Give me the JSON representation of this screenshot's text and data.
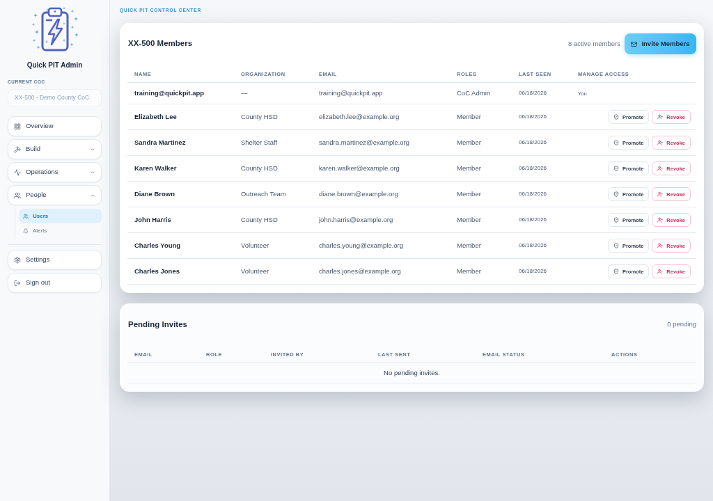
{
  "sidebar": {
    "app_title": "Quick PIT Admin",
    "coc_label": "CURRENT COC",
    "coc_field": {
      "value": "XX-500 - Demo County CoC",
      "disabled": true
    },
    "nav": [
      {
        "kind": "link",
        "label": "Overview"
      },
      {
        "kind": "group",
        "label": "Build",
        "expanded": false
      },
      {
        "kind": "group",
        "label": "Operations",
        "expanded": false
      },
      {
        "kind": "group",
        "label": "People",
        "expanded": true,
        "children": [
          {
            "label": "Users",
            "selected": true
          },
          {
            "label": "Alerts",
            "selected": false
          }
        ]
      }
    ],
    "footer_nav": [
      {
        "label": "Settings"
      },
      {
        "label": "Sign out"
      }
    ]
  },
  "header": {
    "eyebrow": "QUICK PIT CONTROL CENTER"
  },
  "members_card": {
    "title": "XX-500 Members",
    "count": "8 active members",
    "invite_button": "Invite Members",
    "table": {
      "columns": [
        "NAME",
        "ORGANIZATION",
        "EMAIL",
        "ROLES",
        "LAST SEEN",
        "MANAGE ACCESS"
      ],
      "rows": [
        {
          "name": "training@quickpit.app",
          "organization": "—",
          "email": "training@quickpit.app",
          "roles": "CoC Admin",
          "last_seen": "06/18/2026",
          "manage_access": [
            {
              "kind": "note",
              "label": "You"
            }
          ]
        },
        {
          "name": "Elizabeth Lee",
          "organization": "County HSD",
          "email": "elizabeth.lee@example.org",
          "roles": "Member",
          "last_seen": "06/18/2026",
          "manage_access": [
            {
              "kind": "promote",
              "label": "Promote"
            },
            {
              "kind": "revoke",
              "label": "Revoke"
            }
          ]
        },
        {
          "name": "Sandra Martinez",
          "organization": "Shelter Staff",
          "email": "sandra.martinez@example.org",
          "roles": "Member",
          "last_seen": "06/18/2026",
          "manage_access": [
            {
              "kind": "promote",
              "label": "Promote"
            },
            {
              "kind": "revoke",
              "label": "Revoke"
            }
          ]
        },
        {
          "name": "Karen Walker",
          "organization": "County HSD",
          "email": "karen.walker@example.org",
          "roles": "Member",
          "last_seen": "06/18/2026",
          "manage_access": [
            {
              "kind": "promote",
              "label": "Promote"
            },
            {
              "kind": "revoke",
              "label": "Revoke"
            }
          ]
        },
        {
          "name": "Diane Brown",
          "organization": "Outreach Team",
          "email": "diane.brown@example.org",
          "roles": "Member",
          "last_seen": "06/18/2026",
          "manage_access": [
            {
              "kind": "promote",
              "label": "Promote"
            },
            {
              "kind": "revoke",
              "label": "Revoke"
            }
          ]
        },
        {
          "name": "John Harris",
          "organization": "County HSD",
          "email": "john.harris@example.org",
          "roles": "Member",
          "last_seen": "06/18/2026",
          "manage_access": [
            {
              "kind": "promote",
              "label": "Promote"
            },
            {
              "kind": "revoke",
              "label": "Revoke"
            }
          ]
        },
        {
          "name": "Charles Young",
          "organization": "Volunteer",
          "email": "charles.young@example.org",
          "roles": "Member",
          "last_seen": "06/18/2026",
          "manage_access": [
            {
              "kind": "promote",
              "label": "Promote"
            },
            {
              "kind": "revoke",
              "label": "Revoke"
            }
          ]
        },
        {
          "name": "Charles Jones",
          "organization": "Volunteer",
          "email": "charles.jones@example.org",
          "roles": "Member",
          "last_seen": "06/18/2026",
          "manage_access": [
            {
              "kind": "promote",
              "label": "Promote"
            },
            {
              "kind": "revoke",
              "label": "Revoke"
            }
          ]
        }
      ]
    }
  },
  "pending_card": {
    "title": "Pending Invites",
    "count": "0 pending",
    "table": {
      "columns": [
        "EMAIL",
        "ROLE",
        "INVITED BY",
        "LAST SENT",
        "EMAIL STATUS",
        "ACTIONS"
      ],
      "empty_message": "No pending invites."
    }
  }
}
